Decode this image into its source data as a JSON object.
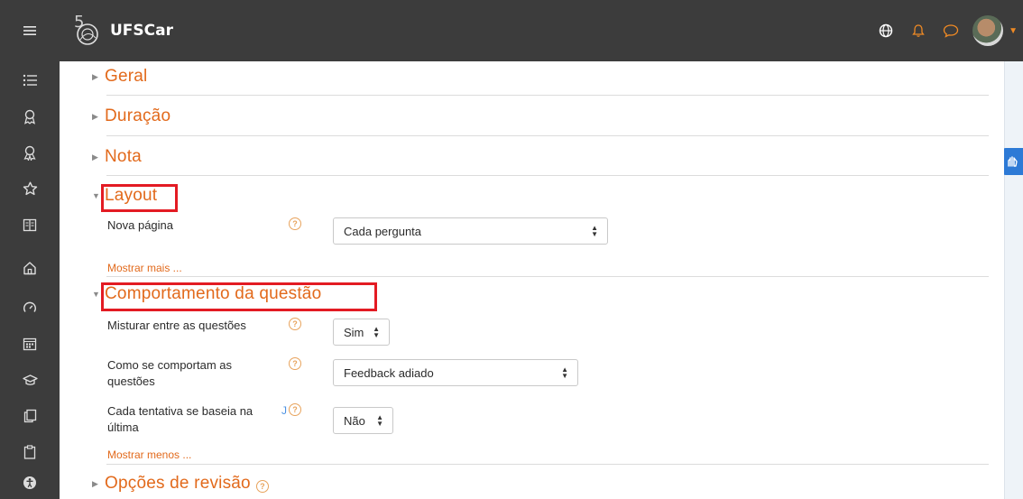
{
  "brand": {
    "name": "UFSCar"
  },
  "navbar": {
    "menu_icon": "hamburger-icon",
    "icons": [
      "globe-icon",
      "bell-icon",
      "chat-icon"
    ],
    "accent": "#f08a24"
  },
  "sidebar": {
    "icons": [
      "list-icon",
      "badge-icon",
      "award-icon",
      "star-icon",
      "book-icon",
      "home-icon",
      "gauge-icon",
      "calendar-icon",
      "graduation-cap-icon",
      "files-icon",
      "clipboard-icon",
      "accessibility-icon"
    ]
  },
  "sections": {
    "geral": "Geral",
    "duracao": "Duração",
    "nota": "Nota",
    "layout": "Layout",
    "comportamento": "Comportamento da questão",
    "revisao": "Opções de revisão"
  },
  "layout": {
    "nova_pagina_label": "Nova página",
    "nova_pagina_value": "Cada pergunta",
    "mostrar_mais": "Mostrar mais ..."
  },
  "comportamento": {
    "misturar_label": "Misturar entre as questões",
    "misturar_value": "Sim",
    "como_label_1": "Como se comportam as",
    "como_label_2": "questões",
    "como_value": "Feedback adiado",
    "cada_label_1": "Cada tentativa se baseia na",
    "cada_label_2": "última",
    "cada_mark": "J",
    "cada_value": "Não",
    "mostrar_menos": "Mostrar menos ..."
  },
  "colors": {
    "accent": "#e26a1c",
    "highlight": "#e31b23",
    "sidebar": "#3c3c3c"
  }
}
